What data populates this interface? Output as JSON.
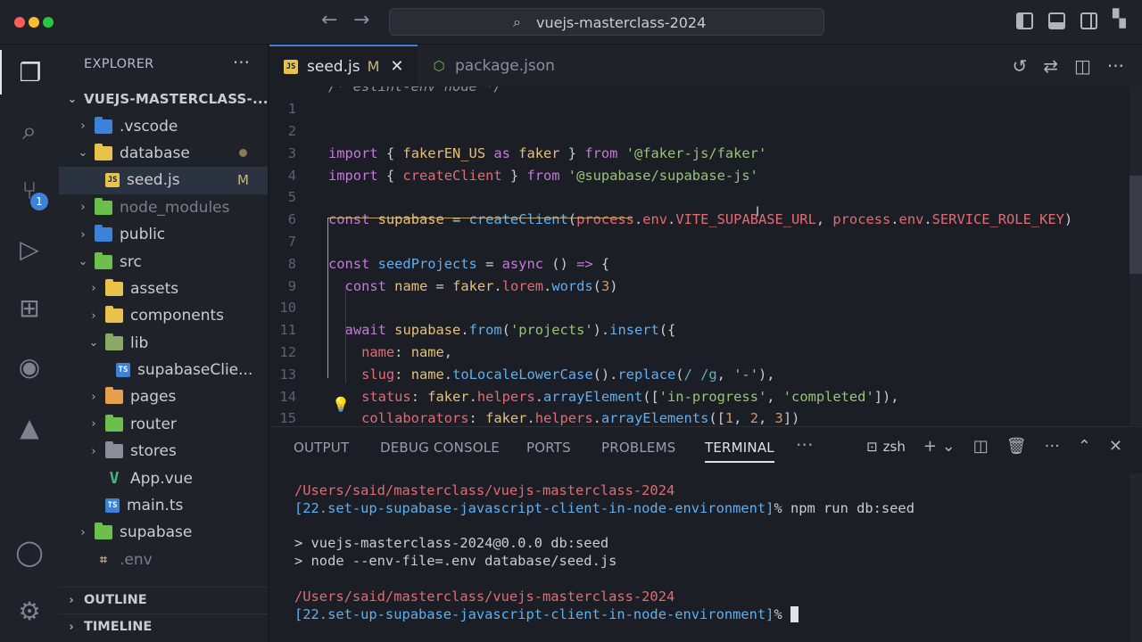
{
  "window": {
    "search_label": "vuejs-masterclass-2024"
  },
  "sidebar": {
    "title": "EXPLORER",
    "root": "VUEJS-MASTERCLASS-...",
    "items": [
      {
        "label": ".vscode",
        "depth": 1,
        "expanded": false,
        "icon_color": "#3b82d8"
      },
      {
        "label": "database",
        "depth": 1,
        "expanded": true,
        "icon_color": "#e8c34a",
        "has_dot": true
      },
      {
        "label": "seed.js",
        "depth": 2,
        "file": true,
        "icon": "JS",
        "selected": true,
        "status": "M"
      },
      {
        "label": "node_modules",
        "depth": 1,
        "expanded": false,
        "icon_color": "#6cbf4b",
        "dim": true
      },
      {
        "label": "public",
        "depth": 1,
        "expanded": false,
        "icon_color": "#3b82d8"
      },
      {
        "label": "src",
        "depth": 1,
        "expanded": true,
        "icon_color": "#6cbf4b"
      },
      {
        "label": "assets",
        "depth": 2,
        "expanded": false,
        "icon_color": "#e8c34a"
      },
      {
        "label": "components",
        "depth": 2,
        "expanded": false,
        "icon_color": "#e8c34a"
      },
      {
        "label": "lib",
        "depth": 2,
        "expanded": true,
        "icon_color": "#8aa86a"
      },
      {
        "label": "supabaseClie...",
        "depth": 3,
        "file": true,
        "icon": "TS"
      },
      {
        "label": "pages",
        "depth": 2,
        "expanded": false,
        "icon_color": "#e8a04a"
      },
      {
        "label": "router",
        "depth": 2,
        "expanded": false,
        "icon_color": "#6cbf4b"
      },
      {
        "label": "stores",
        "depth": 2,
        "expanded": false,
        "icon_color": "#8b8f98"
      },
      {
        "label": "App.vue",
        "depth": 2,
        "file": true,
        "icon": "VUE"
      },
      {
        "label": "main.ts",
        "depth": 2,
        "file": true,
        "icon": "TS"
      },
      {
        "label": "supabase",
        "depth": 1,
        "expanded": false,
        "icon_color": "#6cbf4b"
      },
      {
        "label": ".env",
        "depth": 1,
        "file": true,
        "icon": "ENV",
        "dim": true
      }
    ],
    "bottom": [
      "OUTLINE",
      "TIMELINE"
    ]
  },
  "activity": {
    "scm_badge": "1"
  },
  "editor": {
    "tabs": [
      {
        "label": "seed.js",
        "status": "M",
        "active": true
      },
      {
        "label": "package.json",
        "active": false
      }
    ],
    "lines": [
      {
        "n": "",
        "tokens": [
          [
            "c-com",
            "/* eslint-env node */"
          ]
        ]
      },
      {
        "n": "1",
        "tokens": []
      },
      {
        "n": "2",
        "tokens": []
      },
      {
        "n": "3",
        "tokens": [
          [
            "c-kw",
            "import"
          ],
          [
            "c-pl",
            " { "
          ],
          [
            "c-var",
            "fakerEN_US"
          ],
          [
            "c-kw",
            " as "
          ],
          [
            "c-var",
            "faker"
          ],
          [
            "c-pl",
            " } "
          ],
          [
            "c-kw",
            "from"
          ],
          [
            "c-pl",
            " "
          ],
          [
            "c-str",
            "'@faker-js/faker'"
          ]
        ]
      },
      {
        "n": "4",
        "tokens": [
          [
            "c-kw",
            "import"
          ],
          [
            "c-pl",
            " { "
          ],
          [
            "c-prop",
            "createClient"
          ],
          [
            "c-pl",
            " } "
          ],
          [
            "c-kw",
            "from"
          ],
          [
            "c-pl",
            " "
          ],
          [
            "c-str",
            "'@supabase/supabase-js'"
          ]
        ]
      },
      {
        "n": "5",
        "tokens": []
      },
      {
        "n": "6",
        "tokens": [
          [
            "c-kw",
            "const"
          ],
          [
            "c-pl",
            " "
          ],
          [
            "c-var",
            "supabase"
          ],
          [
            "c-pl",
            " = "
          ],
          [
            "c-fn",
            "createClient"
          ],
          [
            "c-pl",
            "("
          ],
          [
            "c-prop",
            "process"
          ],
          [
            "c-pl",
            "."
          ],
          [
            "c-prop",
            "env"
          ],
          [
            "c-pl",
            "."
          ],
          [
            "c-prop",
            "VITE_SUPABASE_URL"
          ],
          [
            "c-pl",
            ", "
          ],
          [
            "c-prop",
            "process"
          ],
          [
            "c-pl",
            "."
          ],
          [
            "c-prop",
            "env"
          ],
          [
            "c-pl",
            "."
          ],
          [
            "c-prop",
            "SERVICE_ROLE_KEY"
          ],
          [
            "c-pl",
            ")"
          ]
        ]
      },
      {
        "n": "7",
        "tokens": []
      },
      {
        "n": "8",
        "tokens": [
          [
            "c-kw",
            "const"
          ],
          [
            "c-pl",
            " "
          ],
          [
            "c-fn",
            "seedProjects"
          ],
          [
            "c-pl",
            " = "
          ],
          [
            "c-kw",
            "async"
          ],
          [
            "c-pl",
            " () "
          ],
          [
            "c-kw",
            "=>"
          ],
          [
            "c-pl",
            " {"
          ]
        ]
      },
      {
        "n": "9",
        "tokens": [
          [
            "c-pl",
            "  "
          ],
          [
            "c-kw",
            "const"
          ],
          [
            "c-pl",
            " "
          ],
          [
            "c-var",
            "name"
          ],
          [
            "c-pl",
            " = "
          ],
          [
            "c-var",
            "faker"
          ],
          [
            "c-pl",
            "."
          ],
          [
            "c-prop",
            "lorem"
          ],
          [
            "c-pl",
            "."
          ],
          [
            "c-fn",
            "words"
          ],
          [
            "c-pl",
            "("
          ],
          [
            "c-num",
            "3"
          ],
          [
            "c-pl",
            ")"
          ]
        ]
      },
      {
        "n": "10",
        "tokens": []
      },
      {
        "n": "11",
        "tokens": [
          [
            "c-pl",
            "  "
          ],
          [
            "c-kw",
            "await"
          ],
          [
            "c-pl",
            " "
          ],
          [
            "c-var",
            "supabase"
          ],
          [
            "c-pl",
            "."
          ],
          [
            "c-fn",
            "from"
          ],
          [
            "c-pl",
            "("
          ],
          [
            "c-str",
            "'projects'"
          ],
          [
            "c-pl",
            ")."
          ],
          [
            "c-fn",
            "insert"
          ],
          [
            "c-pl",
            "({"
          ]
        ]
      },
      {
        "n": "12",
        "tokens": [
          [
            "c-pl",
            "    "
          ],
          [
            "c-prop",
            "name"
          ],
          [
            "c-pl",
            ": "
          ],
          [
            "c-var",
            "name"
          ],
          [
            "c-pl",
            ","
          ]
        ]
      },
      {
        "n": "13",
        "tokens": [
          [
            "c-pl",
            "    "
          ],
          [
            "c-prop",
            "slug"
          ],
          [
            "c-pl",
            ": "
          ],
          [
            "c-var",
            "name"
          ],
          [
            "c-pl",
            "."
          ],
          [
            "c-fn",
            "toLocaleLowerCase"
          ],
          [
            "c-pl",
            "()."
          ],
          [
            "c-fn",
            "replace"
          ],
          [
            "c-pl",
            "("
          ],
          [
            "c-op",
            "/ /g"
          ],
          [
            "c-pl",
            ", "
          ],
          [
            "c-str",
            "'-'"
          ],
          [
            "c-pl",
            "),"
          ]
        ]
      },
      {
        "n": "14",
        "tokens": [
          [
            "c-pl",
            "    "
          ],
          [
            "c-prop",
            "status"
          ],
          [
            "c-pl",
            ": "
          ],
          [
            "c-var",
            "faker"
          ],
          [
            "c-pl",
            "."
          ],
          [
            "c-prop",
            "helpers"
          ],
          [
            "c-pl",
            "."
          ],
          [
            "c-fn",
            "arrayElement"
          ],
          [
            "c-pl",
            "(["
          ],
          [
            "c-str",
            "'in-progress'"
          ],
          [
            "c-pl",
            ", "
          ],
          [
            "c-str",
            "'completed'"
          ],
          [
            "c-pl",
            "]),"
          ]
        ]
      },
      {
        "n": "15",
        "tokens": [
          [
            "c-pl",
            "    "
          ],
          [
            "c-prop",
            "collaborators"
          ],
          [
            "c-pl",
            ": "
          ],
          [
            "c-var",
            "faker"
          ],
          [
            "c-pl",
            "."
          ],
          [
            "c-prop",
            "helpers"
          ],
          [
            "c-pl",
            "."
          ],
          [
            "c-fn",
            "arrayElements"
          ],
          [
            "c-pl",
            "(["
          ],
          [
            "c-num",
            "1"
          ],
          [
            "c-pl",
            ", "
          ],
          [
            "c-num",
            "2"
          ],
          [
            "c-pl",
            ", "
          ],
          [
            "c-num",
            "3"
          ],
          [
            "c-pl",
            "])"
          ]
        ]
      }
    ]
  },
  "panel": {
    "tabs": [
      "OUTPUT",
      "DEBUG CONSOLE",
      "PORTS",
      "PROBLEMS",
      "TERMINAL"
    ],
    "active_tab": "TERMINAL",
    "shell": "zsh",
    "terminal": {
      "path1": "/Users/said/masterclass/vuejs-masterclass-2024",
      "branch1": "[22.set-up-supabase-javascript-client-in-node-environment]",
      "cmd1": "% npm run db:seed",
      "out1": "> vuejs-masterclass-2024@0.0.0 db:seed",
      "out2": "> node --env-file=.env database/seed.js",
      "path2": "/Users/said/masterclass/vuejs-masterclass-2024",
      "branch2": "[22.set-up-supabase-javascript-client-in-node-environment]",
      "prompt2": "% "
    }
  }
}
